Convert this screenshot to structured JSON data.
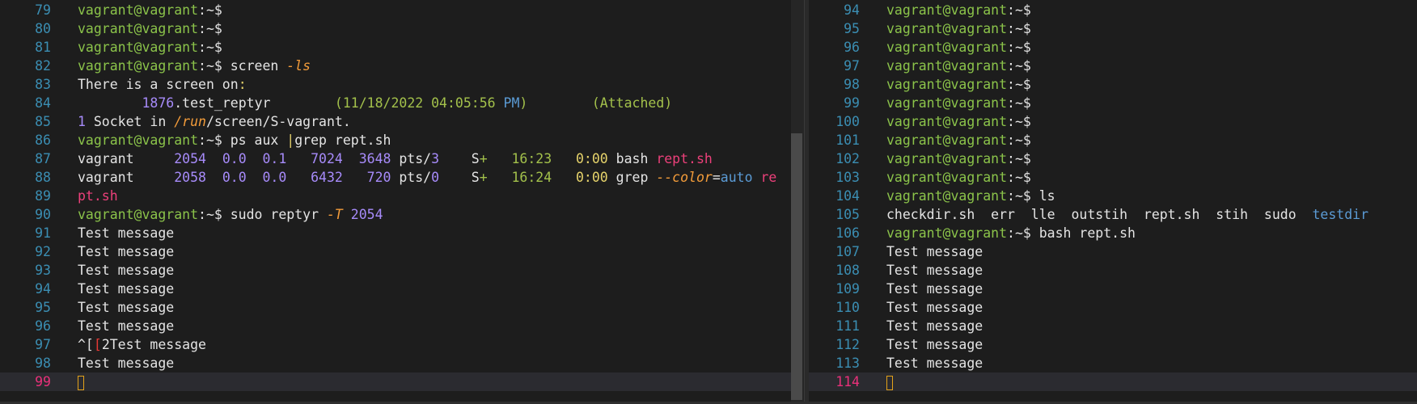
{
  "colors": {
    "background": "#1d1d1d",
    "line_number": "#3b8eb3",
    "current_line_number": "#e9307a",
    "prompt_user": "#8bc34a",
    "cursor": "#e3a21a"
  },
  "left_pane": {
    "lines": [
      {
        "n": "79",
        "segs": [
          [
            "p-user",
            "vagrant@vagrant"
          ],
          [
            "p-sym",
            ":~$"
          ]
        ]
      },
      {
        "n": "80",
        "segs": [
          [
            "p-user",
            "vagrant@vagrant"
          ],
          [
            "p-sym",
            ":~$"
          ]
        ]
      },
      {
        "n": "81",
        "segs": [
          [
            "p-user",
            "vagrant@vagrant"
          ],
          [
            "p-sym",
            ":~$"
          ]
        ]
      },
      {
        "n": "82",
        "segs": [
          [
            "p-user",
            "vagrant@vagrant"
          ],
          [
            "p-sym",
            ":~$ screen "
          ],
          [
            "c-orange-it",
            "-ls"
          ]
        ]
      },
      {
        "n": "83",
        "segs": [
          [
            "c-white",
            "There is a screen on"
          ],
          [
            "c-yellow",
            ":"
          ]
        ]
      },
      {
        "n": "84",
        "segs": [
          [
            "c-white",
            "        "
          ],
          [
            "c-purple",
            "1876"
          ],
          [
            "c-white",
            ".test_reptyr        "
          ],
          [
            "c-paren",
            "(11/18/2022 04:05:56 "
          ],
          [
            "c-blue",
            "PM"
          ],
          [
            "c-paren",
            ")"
          ],
          [
            "c-white",
            "        "
          ],
          [
            "c-paren",
            "(Attached)"
          ]
        ]
      },
      {
        "n": "85",
        "segs": [
          [
            "c-purple",
            "1"
          ],
          [
            "c-white",
            " Socket in "
          ],
          [
            "c-orange-it",
            "/run"
          ],
          [
            "c-white",
            "/screen/S-vagrant."
          ]
        ]
      },
      {
        "n": "86",
        "segs": [
          [
            "p-user",
            "vagrant@vagrant"
          ],
          [
            "p-sym",
            ":~$ ps aux "
          ],
          [
            "c-yellow",
            "|"
          ],
          [
            "c-white",
            "grep rept.sh"
          ]
        ]
      },
      {
        "n": "87",
        "segs": [
          [
            "c-white",
            "vagrant     "
          ],
          [
            "c-purple",
            "2054  0.0  0.1   7024  3648"
          ],
          [
            "c-white",
            " pts/"
          ],
          [
            "c-purple",
            "3"
          ],
          [
            "c-white",
            "    S"
          ],
          [
            "c-green",
            "+"
          ],
          [
            "c-white",
            "   "
          ],
          [
            "c-green",
            "16:23"
          ],
          [
            "c-white",
            "   "
          ],
          [
            "c-yellow",
            "0:00"
          ],
          [
            "c-white",
            " bash "
          ],
          [
            "c-pink",
            "rept.sh"
          ]
        ]
      },
      {
        "n": "88",
        "segs": [
          [
            "c-white",
            "vagrant     "
          ],
          [
            "c-purple",
            "2058  0.0  0.0   6432   720"
          ],
          [
            "c-white",
            " pts/"
          ],
          [
            "c-purple",
            "0"
          ],
          [
            "c-white",
            "    S"
          ],
          [
            "c-green",
            "+"
          ],
          [
            "c-white",
            "   "
          ],
          [
            "c-green",
            "16:24"
          ],
          [
            "c-white",
            "   "
          ],
          [
            "c-yellow",
            "0:00"
          ],
          [
            "c-white",
            " grep "
          ],
          [
            "c-orange-it",
            "--color"
          ],
          [
            "c-white",
            "="
          ],
          [
            "c-blue",
            "auto"
          ],
          [
            "c-white",
            " "
          ],
          [
            "c-pink",
            "re"
          ]
        ]
      },
      {
        "n": "89",
        "segs": [
          [
            "c-pink",
            "pt.sh"
          ]
        ]
      },
      {
        "n": "90",
        "segs": [
          [
            "p-user",
            "vagrant@vagrant"
          ],
          [
            "p-sym",
            ":~$ sudo reptyr "
          ],
          [
            "c-orange-it",
            "-T"
          ],
          [
            "c-white",
            " "
          ],
          [
            "c-purple",
            "2054"
          ]
        ]
      },
      {
        "n": "91",
        "segs": [
          [
            "c-white",
            "Test message"
          ]
        ]
      },
      {
        "n": "92",
        "segs": [
          [
            "c-white",
            "Test message"
          ]
        ]
      },
      {
        "n": "93",
        "segs": [
          [
            "c-white",
            "Test message"
          ]
        ]
      },
      {
        "n": "94",
        "segs": [
          [
            "c-white",
            "Test message"
          ]
        ]
      },
      {
        "n": "95",
        "segs": [
          [
            "c-white",
            "Test message"
          ]
        ]
      },
      {
        "n": "96",
        "segs": [
          [
            "c-white",
            "Test message"
          ]
        ]
      },
      {
        "n": "97",
        "segs": [
          [
            "c-white",
            "^["
          ],
          [
            "c-red",
            "["
          ],
          [
            "c-white",
            "2Test message"
          ]
        ]
      },
      {
        "n": "98",
        "segs": [
          [
            "c-white",
            "Test message"
          ]
        ]
      },
      {
        "n": "99",
        "segs": [],
        "current": true
      }
    ]
  },
  "right_pane": {
    "lines": [
      {
        "n": "94",
        "segs": [
          [
            "p-user",
            "vagrant@vagrant"
          ],
          [
            "p-sym",
            ":~$"
          ]
        ]
      },
      {
        "n": "95",
        "segs": [
          [
            "p-user",
            "vagrant@vagrant"
          ],
          [
            "p-sym",
            ":~$"
          ]
        ]
      },
      {
        "n": "96",
        "segs": [
          [
            "p-user",
            "vagrant@vagrant"
          ],
          [
            "p-sym",
            ":~$"
          ]
        ]
      },
      {
        "n": "97",
        "segs": [
          [
            "p-user",
            "vagrant@vagrant"
          ],
          [
            "p-sym",
            ":~$"
          ]
        ]
      },
      {
        "n": "98",
        "segs": [
          [
            "p-user",
            "vagrant@vagrant"
          ],
          [
            "p-sym",
            ":~$"
          ]
        ]
      },
      {
        "n": "99",
        "segs": [
          [
            "p-user",
            "vagrant@vagrant"
          ],
          [
            "p-sym",
            ":~$"
          ]
        ]
      },
      {
        "n": "100",
        "segs": [
          [
            "p-user",
            "vagrant@vagrant"
          ],
          [
            "p-sym",
            ":~$"
          ]
        ]
      },
      {
        "n": "101",
        "segs": [
          [
            "p-user",
            "vagrant@vagrant"
          ],
          [
            "p-sym",
            ":~$"
          ]
        ]
      },
      {
        "n": "102",
        "segs": [
          [
            "p-user",
            "vagrant@vagrant"
          ],
          [
            "p-sym",
            ":~$"
          ]
        ]
      },
      {
        "n": "103",
        "segs": [
          [
            "p-user",
            "vagrant@vagrant"
          ],
          [
            "p-sym",
            ":~$"
          ]
        ]
      },
      {
        "n": "104",
        "segs": [
          [
            "p-user",
            "vagrant@vagrant"
          ],
          [
            "p-sym",
            ":~$ ls"
          ]
        ]
      },
      {
        "n": "105",
        "segs": [
          [
            "c-white",
            "checkdir.sh  err  lle  outstih  rept.sh  stih  sudo  "
          ],
          [
            "c-blue",
            "testdir"
          ]
        ]
      },
      {
        "n": "106",
        "segs": [
          [
            "p-user",
            "vagrant@vagrant"
          ],
          [
            "p-sym",
            ":~$ bash rept.sh"
          ]
        ]
      },
      {
        "n": "107",
        "segs": [
          [
            "c-white",
            "Test message"
          ]
        ]
      },
      {
        "n": "108",
        "segs": [
          [
            "c-white",
            "Test message"
          ]
        ]
      },
      {
        "n": "109",
        "segs": [
          [
            "c-white",
            "Test message"
          ]
        ]
      },
      {
        "n": "110",
        "segs": [
          [
            "c-white",
            "Test message"
          ]
        ]
      },
      {
        "n": "111",
        "segs": [
          [
            "c-white",
            "Test message"
          ]
        ]
      },
      {
        "n": "112",
        "segs": [
          [
            "c-white",
            "Test message"
          ]
        ]
      },
      {
        "n": "113",
        "segs": [
          [
            "c-white",
            "Test message"
          ]
        ]
      },
      {
        "n": "114",
        "segs": [],
        "current": true
      }
    ]
  }
}
